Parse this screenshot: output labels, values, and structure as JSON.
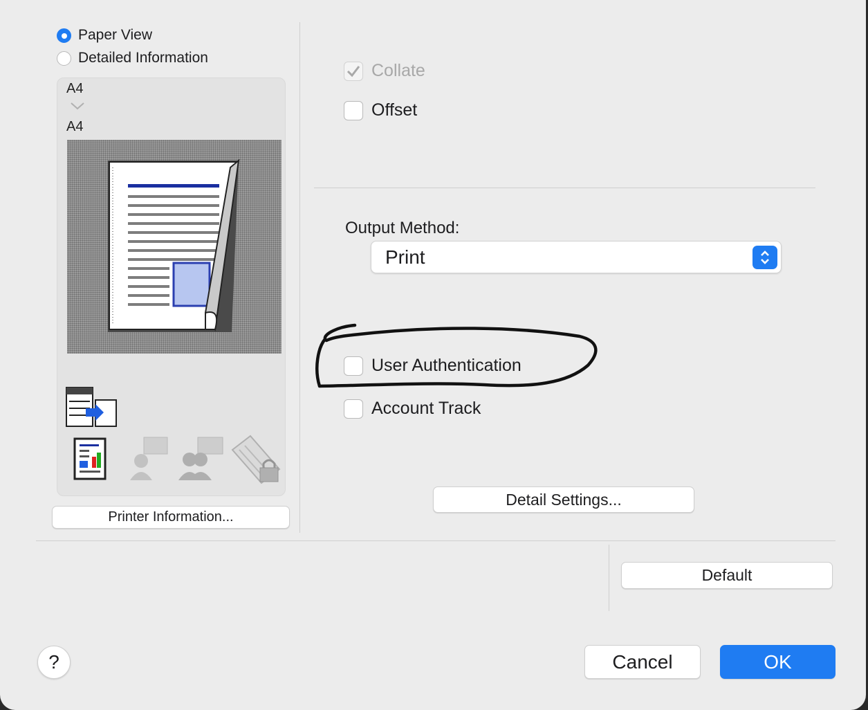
{
  "view_options": {
    "paper_view_label": "Paper View",
    "detailed_info_label": "Detailed Information",
    "selected": "Paper View"
  },
  "preview": {
    "input_paper": "A4",
    "output_paper": "A4"
  },
  "printer_info_button": "Printer Information...",
  "options": {
    "collate_label": "Collate",
    "collate_checked": true,
    "collate_disabled": true,
    "offset_label": "Offset",
    "offset_checked": false
  },
  "output_method": {
    "label": "Output Method:",
    "value": "Print"
  },
  "authentication": {
    "user_auth_label": "User Authentication",
    "user_auth_checked": false,
    "account_track_label": "Account Track",
    "account_track_checked": false
  },
  "detail_settings_button": "Detail Settings...",
  "default_button": "Default",
  "help_button": "?",
  "cancel_button": "Cancel",
  "ok_button": "OK",
  "colors": {
    "accent": "#1f7cf2",
    "annotation_ink": "#111111"
  }
}
